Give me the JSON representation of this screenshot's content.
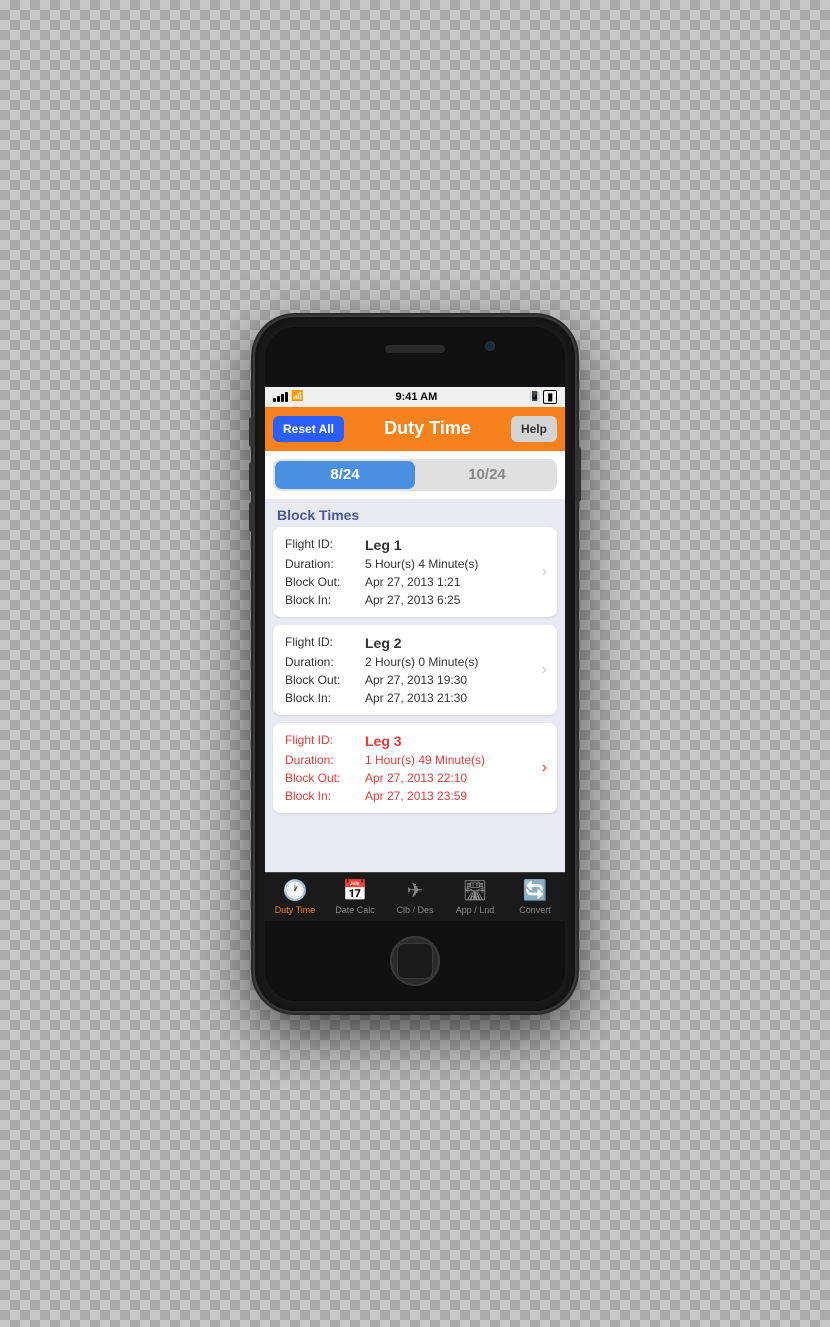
{
  "phone": {
    "status_bar": {
      "signal": "●●●●",
      "wifi": "WiFi",
      "time": "9:41 AM",
      "bluetooth": "BT",
      "battery": "Battery"
    },
    "nav_bar": {
      "reset_label": "Reset All",
      "title": "Duty Time",
      "help_label": "Help"
    },
    "segmented": {
      "option1": "8/24",
      "option2": "10/24"
    },
    "section_header": "Block Times",
    "flights": [
      {
        "id": "Leg 1",
        "duration": "5 Hour(s) 4 Minute(s)",
        "block_out": "Apr 27, 2013 1:21",
        "block_in": "Apr 27, 2013 6:25",
        "warning": false
      },
      {
        "id": "Leg 2",
        "duration": "2 Hour(s) 0 Minute(s)",
        "block_out": "Apr 27, 2013 19:30",
        "block_in": "Apr 27, 2013 21:30",
        "warning": false
      },
      {
        "id": "Leg 3",
        "duration": "1 Hour(s) 49 Minute(s)",
        "block_out": "Apr 27, 2013 22:10",
        "block_in": "Apr 27, 2013 23:59",
        "warning": true
      }
    ],
    "tab_bar": {
      "items": [
        {
          "label": "Duty Time",
          "icon": "🕐",
          "active": true
        },
        {
          "label": "Date Calc",
          "icon": "🖩",
          "active": false
        },
        {
          "label": "Clb / Des",
          "icon": "✈",
          "active": false
        },
        {
          "label": "App / Lnd",
          "icon": "🛣",
          "active": false
        },
        {
          "label": "Convert",
          "icon": "🔄",
          "active": false
        }
      ]
    },
    "flight_id_label": "Flight ID:",
    "duration_label": "Duration:",
    "block_out_label": "Block Out:",
    "block_in_label": "Block In:"
  }
}
